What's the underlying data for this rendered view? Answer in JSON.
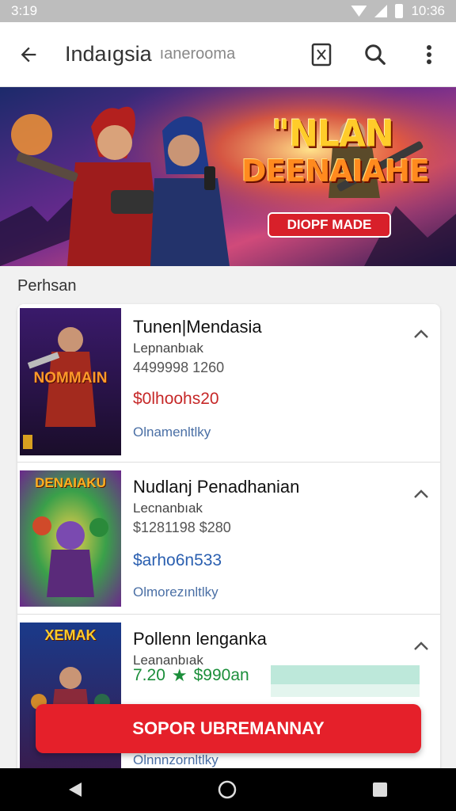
{
  "status_bar": {
    "time": "3:19",
    "clock_right": "10:36",
    "icons": [
      "wifi-icon",
      "signal-icon",
      "battery-icon"
    ]
  },
  "app_bar": {
    "title": "Indaıgsia",
    "subtitle": "ıanerooma",
    "icons": [
      "back-arrow-icon",
      "bookmark-icon",
      "search-icon",
      "more-vert-icon"
    ]
  },
  "banner": {
    "headline_line1": "\"NLAN",
    "headline_line2": "DEENAIAHE",
    "badge": "DIOPF MADE"
  },
  "section": {
    "title": "Perhsan"
  },
  "games": [
    {
      "name": "Tunen|Mendasia",
      "developer": "Lepnanbıak",
      "meta": "4499998 1260",
      "price": "$0lhoohs20",
      "price_color": "#c62828",
      "link": "Olnamenltlky",
      "cover_title": "NOMMAIN",
      "cover_color": "#7b2a8b"
    },
    {
      "name": "Nudlanj Penadhanian",
      "developer": "Lecnanbıak",
      "meta": "$1281198 $280",
      "price": "$arho6n533",
      "price_color": "#2a5fb0",
      "link": "Olmorezınltlky",
      "cover_title": "DENAIAKU",
      "cover_color": "#2f8f3a"
    },
    {
      "name": "Pollenn lenganka",
      "developer": "Leananbıak",
      "meta": "",
      "rating": "7.20",
      "rating_value": "$990an",
      "link": "Olnnnzornltlky",
      "cover_title": "XEMAK",
      "cover_color": "#1a3a7a"
    }
  ],
  "cta": {
    "label": "SOPOR UBREMANNAY"
  },
  "colors": {
    "accent": "#e5202a",
    "rating_green": "#1b8e3a"
  },
  "nav_bar": {
    "icons": [
      "nav-back-icon",
      "nav-home-icon",
      "nav-recents-icon"
    ]
  }
}
